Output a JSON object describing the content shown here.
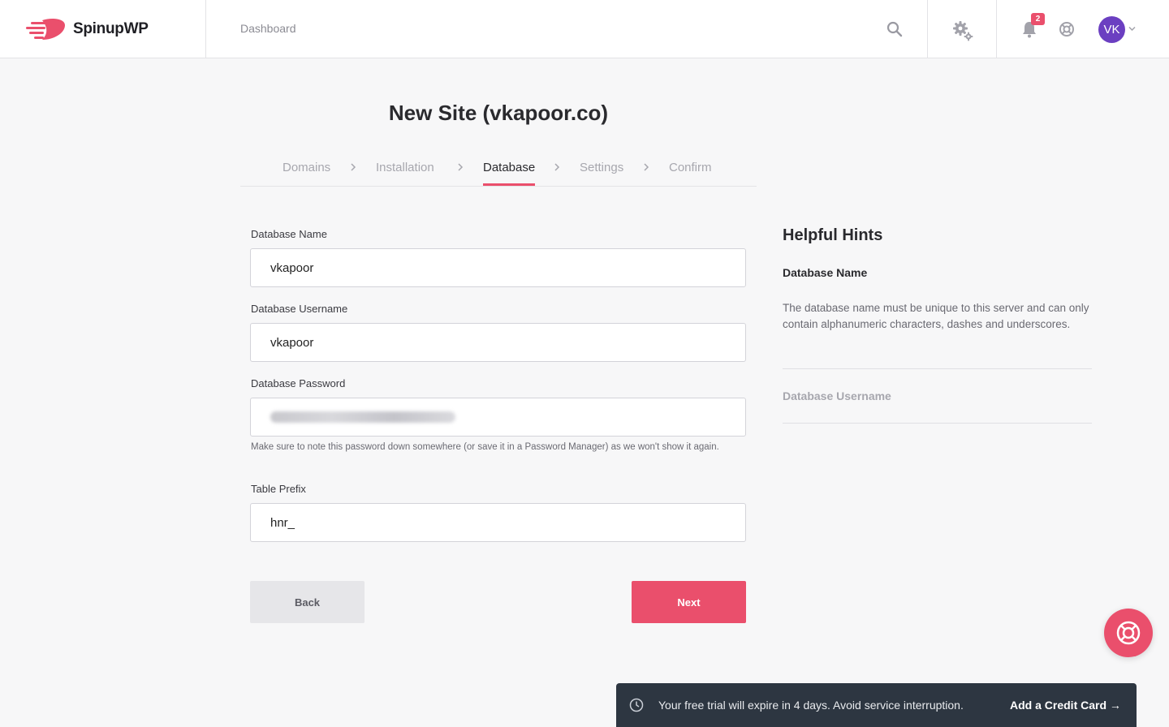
{
  "header": {
    "brand": "SpinupWP",
    "nav_dashboard": "Dashboard",
    "notification_count": "2",
    "avatar_initials": "VK"
  },
  "page": {
    "title": "New Site (vkapoor.co)"
  },
  "steps": [
    "Domains",
    "Installation",
    "Database",
    "Settings",
    "Confirm"
  ],
  "active_step": "Database",
  "form": {
    "db_name_label": "Database Name",
    "db_name_value": "vkapoor",
    "db_user_label": "Database Username",
    "db_user_value": "vkapoor",
    "db_pass_label": "Database Password",
    "db_pass_note": "Make sure to note this password down somewhere (or save it in a Password Manager) as we won't show it again.",
    "table_prefix_label": "Table Prefix",
    "table_prefix_value": "hnr_",
    "back_label": "Back",
    "next_label": "Next"
  },
  "hints": {
    "title": "Helpful Hints",
    "items": [
      {
        "title": "Database Name",
        "body": "The database name must be unique to this server and can only contain alphanumeric characters, dashes and underscores.",
        "expanded": true
      },
      {
        "title": "Database Username",
        "expanded": false
      }
    ]
  },
  "trial_banner": {
    "text": "Your free trial will expire in 4 days. Avoid service interruption.",
    "link": "Add a Credit Card →"
  },
  "colors": {
    "accent": "#ea4f6c",
    "avatar": "#6b3fc1",
    "banner_bg": "#2d3641"
  },
  "icons": [
    "logo-mark-icon",
    "search-icon",
    "gear-icon",
    "bell-icon",
    "lifebuoy-icon",
    "chevron-down-icon",
    "chevron-right-icon",
    "clock-icon"
  ]
}
